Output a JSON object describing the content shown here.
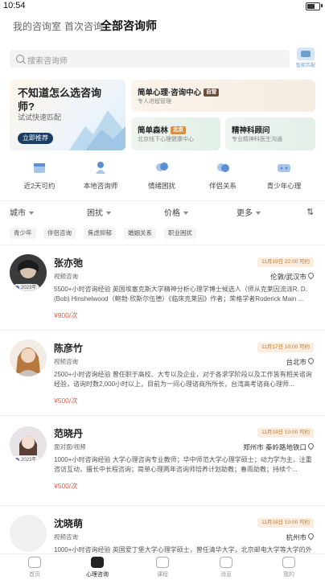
{
  "status": {
    "time": "10:54"
  },
  "tabs": [
    {
      "label": "我的咨询室",
      "active": false
    },
    {
      "label": "首次咨询",
      "active": false
    },
    {
      "label": "全部咨询师",
      "active": true
    }
  ],
  "search": {
    "placeholder": "搜索咨询师",
    "filter_label": "智能匹配"
  },
  "banner": {
    "title": "不知道怎么选咨询师?",
    "subtitle": "试试快速匹配",
    "button": "立即推荐"
  },
  "cards": [
    {
      "title": "简单心理·咨询中心",
      "tag": "自营",
      "subtitle": "专人进程管理"
    },
    {
      "title": "简单森林",
      "tag": "北京",
      "subtitle": "北京线下心理健康中心"
    },
    {
      "title": "精神科顾问",
      "tag": "",
      "subtitle": "专业精神科医生沟通"
    }
  ],
  "categories": [
    {
      "label": "近2天可约",
      "icon": "calendar-icon",
      "color": "#5b8fd6"
    },
    {
      "label": "本地咨询师",
      "icon": "location-person-icon",
      "color": "#5b8fd6"
    },
    {
      "label": "情绪困扰",
      "icon": "cloud-icon",
      "color": "#5b8fd6"
    },
    {
      "label": "伴侣关系",
      "icon": "chat-bubbles-icon",
      "color": "#5b8fd6"
    },
    {
      "label": "青少年心理",
      "icon": "teen-icon",
      "color": "#5b8fd6"
    }
  ],
  "sorts": [
    {
      "label": "城市"
    },
    {
      "label": "困扰"
    },
    {
      "label": "价格"
    },
    {
      "label": "更多"
    }
  ],
  "chips": [
    "青少年",
    "伴侣咨询",
    "焦虑抑郁",
    "婚姻关系",
    "职业困扰"
  ],
  "counselors": [
    {
      "name": "张亦弛",
      "method": "视频咨询",
      "appointment": "11月19日 22:00 可约",
      "city": "伦敦/武汉市",
      "desc": "5500+小时咨询经验 英国埃塞克斯大学精神分析心理学博士候选人（师从克莱因流派R. D. (Bob) Hinshelwood（鲍勃·欣斯尔伍德）《临床克莱因》作者；荣格学者Roderick Main ...",
      "price": "¥900/次",
      "year": "2023年",
      "avatar_color": "#3a3a3a"
    },
    {
      "name": "陈彦竹",
      "method": "视频咨询",
      "appointment": "11月17日 10:00 可约",
      "city": "台北市",
      "desc": "2500+小时咨询经验 曾任职于高校、大专以及企业，对于各求学阶段以及工作皆有相关谘询经验，谘询时数2,000小时以上，目前为一间心理谘商所所长，台湾高考谘商心理师...",
      "price": "¥500/次",
      "year": "",
      "avatar_color": "#c98a4e"
    },
    {
      "name": "范晓丹",
      "method": "面对面/视频",
      "appointment": "11月19日 10:00 可约",
      "city": "郑州市 秦岭路地铁口",
      "desc": "1000+小时咨询经验 大学心理咨询专业教师；华中师范大学心理学硕士；动力学为主，注重咨访互动，擅长中长程咨询；简单心理两年咨询师培养计划助教；春雨助教；持续个...",
      "price": "¥500/次",
      "year": "2023年",
      "avatar_color": "#e7e2e6"
    },
    {
      "name": "沈晓萌",
      "method": "视频咨询",
      "appointment": "11月18日 10:00 可约",
      "city": "杭州市",
      "desc": "1000+小时咨询经验 英国爱丁堡大学心理学硕士，曾任清华大学，北京邮电大学等大学的外",
      "price": "",
      "year": "",
      "avatar_color": "#f0f0f0"
    }
  ],
  "bottom_nav": [
    {
      "label": "首页",
      "active": false
    },
    {
      "label": "心理咨询",
      "active": true
    },
    {
      "label": "课程",
      "active": false
    },
    {
      "label": "消息",
      "active": false
    },
    {
      "label": "我的",
      "active": false
    }
  ]
}
